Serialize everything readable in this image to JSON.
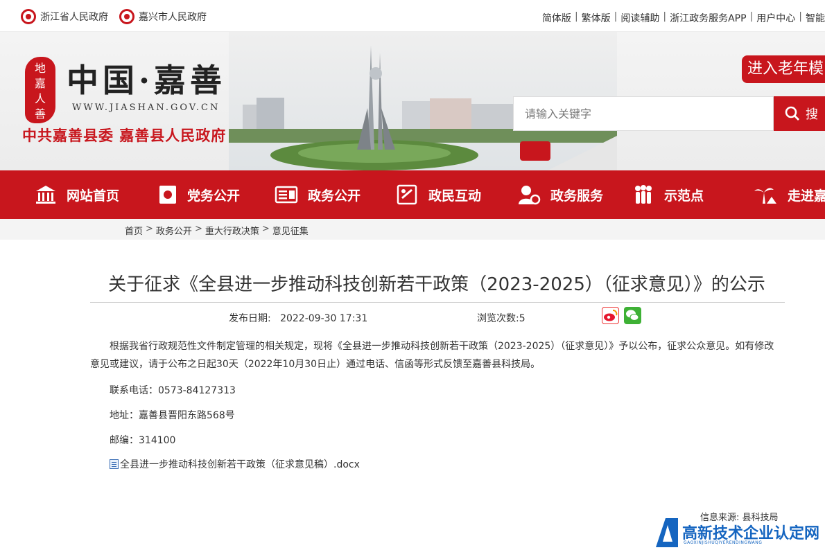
{
  "topbar": {
    "province_link": "浙江省人民政府",
    "city_link": "嘉兴市人民政府",
    "right_links": [
      "简体版",
      "繁体版",
      "阅读辅助",
      "浙江政务服务APP",
      "用户中心",
      "智能"
    ]
  },
  "header": {
    "seal_text": "地嘉人善",
    "site_name": "中国·嘉善",
    "site_url": "WWW.JIASHAN.GOV.CN",
    "subtitle": "中共嘉善县委  嘉善县人民政府",
    "elder_mode_label": "进入老年模",
    "search_placeholder": "请输入关键字",
    "search_button": "搜"
  },
  "nav": {
    "items": [
      {
        "label": "网站首页",
        "icon": "home-icon"
      },
      {
        "label": "党务公开",
        "icon": "party-icon"
      },
      {
        "label": "政务公开",
        "icon": "gov-affairs-icon"
      },
      {
        "label": "政民互动",
        "icon": "interaction-icon"
      },
      {
        "label": "政务服务",
        "icon": "service-icon"
      },
      {
        "label": "示范点",
        "icon": "people-icon"
      },
      {
        "label": "走进嘉",
        "icon": "palm-icon"
      }
    ]
  },
  "breadcrumb": [
    "首页",
    "政务公开",
    "重大行政决策",
    "意见征集"
  ],
  "article": {
    "title": "关于征求《全县进一步推动科技创新若干政策（2023-2025）（征求意见）》的公示",
    "publish_label": "发布日期:",
    "publish_date": "2022-09-30 17:31",
    "views_label": "浏览次数:",
    "views": "5",
    "body": "根据我省行政规范性文件制定管理的相关规定，现将《全县进一步推动科技创新若干政策（2023-2025）（征求意见）》予以公布，征求公众意见。如有修改意见或建议，请于公布之日起30天（2022年10月30日止）通过电话、信函等形式反馈至嘉善县科技局。",
    "phone": "联系电话：0573-84127313",
    "address": "地址：嘉善县晋阳东路568号",
    "postcode": "邮编：314100",
    "attachment": "全县进一步推动科技创新若干政策（征求意见稿）.docx",
    "source": "信息来源:   县科技局"
  },
  "watermark": {
    "text": "高新技术企业认定网",
    "sub": "GAOXINJISHUQIYERENDINGWANG"
  },
  "colors": {
    "brand_red": "#c8161d",
    "watermark_blue": "#1565c0"
  }
}
